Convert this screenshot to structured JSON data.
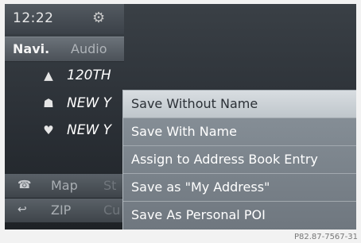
{
  "status": {
    "time": "12:22",
    "icon": "gear-icon"
  },
  "tabs": [
    {
      "label": "Navi."
    },
    {
      "label": "Audio"
    }
  ],
  "destinations": [
    {
      "icon": "flag-icon",
      "label": "120TH"
    },
    {
      "icon": "people-icon",
      "label": "NEW Y"
    },
    {
      "icon": "heart-icon",
      "label": "NEW Y"
    }
  ],
  "bottom_nav": [
    {
      "icon": "phone-icon",
      "label": "Map",
      "label2": "St"
    },
    {
      "icon": "back-icon",
      "label": "ZIP",
      "label2": "Cu"
    }
  ],
  "menu": {
    "selected_index": 0,
    "items": [
      "Save Without Name",
      "Save With Name",
      "Assign to Address Book Entry",
      "Save as \"My Address\"",
      "Save As Personal POI"
    ]
  },
  "watermark": "P82.87-7567-31"
}
